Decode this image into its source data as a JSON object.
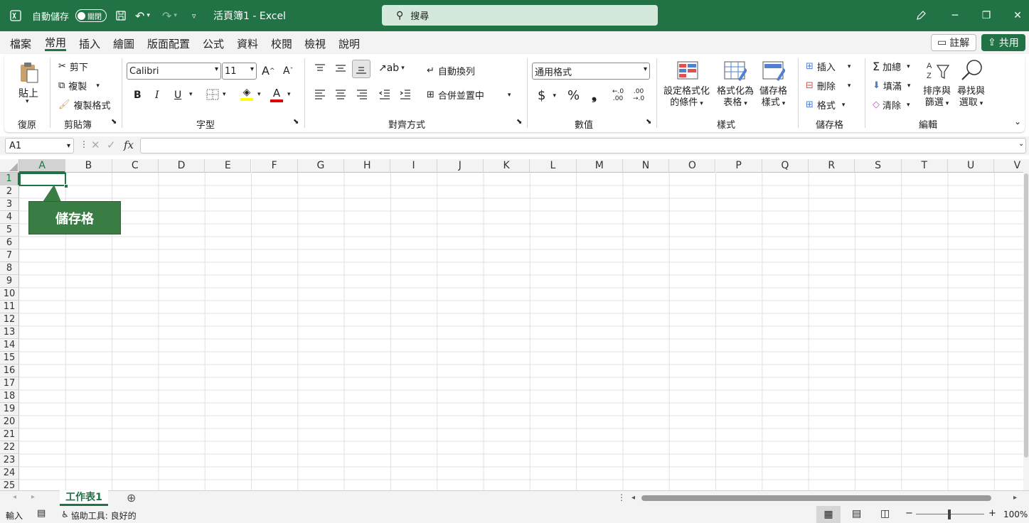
{
  "titlebar": {
    "autosave_label": "自動儲存",
    "autosave_state": "關閉",
    "title": "活頁簿1 - Excel",
    "search_placeholder": "搜尋",
    "minimize": "─",
    "restore": "❐",
    "close": "✕"
  },
  "menu": {
    "items": [
      "檔案",
      "常用",
      "插入",
      "繪圖",
      "版面配置",
      "公式",
      "資料",
      "校閱",
      "檢視",
      "說明"
    ],
    "active_index": 1,
    "comment_label": "註解",
    "share_label": "共用"
  },
  "ribbon": {
    "clipboard": {
      "paste": "貼上",
      "cut": "剪下",
      "copy": "複製",
      "format_painter": "複製格式",
      "group": "剪貼簿",
      "undo_group": "復原"
    },
    "font": {
      "name": "Calibri",
      "size": "11",
      "group": "字型",
      "bold": "B",
      "italic": "I",
      "underline": "U"
    },
    "alignment": {
      "wrap": "自動換列",
      "merge": "合併並置中",
      "group": "對齊方式"
    },
    "number": {
      "format": "通用格式",
      "currency": "$",
      "percent": "%",
      "comma": "❟",
      "inc_decimal_a": ".00",
      "inc_decimal_b": ".0",
      "dec_decimal_a": ".00",
      "dec_decimal_b": "→.0",
      "group": "數值"
    },
    "styles": {
      "conditional_a": "設定格式化",
      "conditional_b": "的條件",
      "table_a": "格式化為",
      "table_b": "表格",
      "cell_a": "儲存格",
      "cell_b": "樣式",
      "group": "樣式"
    },
    "cells": {
      "insert": "插入",
      "delete": "刪除",
      "format": "格式",
      "group": "儲存格"
    },
    "editing": {
      "autosum": "加總",
      "fill": "填滿",
      "clear": "清除",
      "sort_a": "排序與",
      "sort_b": "篩選",
      "find_a": "尋找與",
      "find_b": "選取",
      "group": "編輯"
    }
  },
  "formula": {
    "namebox": "A1",
    "fx": "fx"
  },
  "columns": [
    "A",
    "B",
    "C",
    "D",
    "E",
    "F",
    "G",
    "H",
    "I",
    "J",
    "K",
    "L",
    "M",
    "N",
    "O",
    "P",
    "Q",
    "R",
    "S",
    "T",
    "U",
    "V"
  ],
  "rows": [
    "1",
    "2",
    "3",
    "4",
    "5",
    "6",
    "7",
    "8",
    "9",
    "10",
    "11",
    "12",
    "13",
    "14",
    "15",
    "16",
    "17",
    "18",
    "19",
    "20",
    "21",
    "22",
    "23",
    "24",
    "25"
  ],
  "callout": "儲存格",
  "sheet": {
    "tab": "工作表1",
    "add": "⊕"
  },
  "status": {
    "mode": "輸入",
    "accessibility": "協助工具: 良好的",
    "zoom": "100%"
  },
  "colors": {
    "accent": "#217346",
    "callout": "#3a7d44"
  }
}
